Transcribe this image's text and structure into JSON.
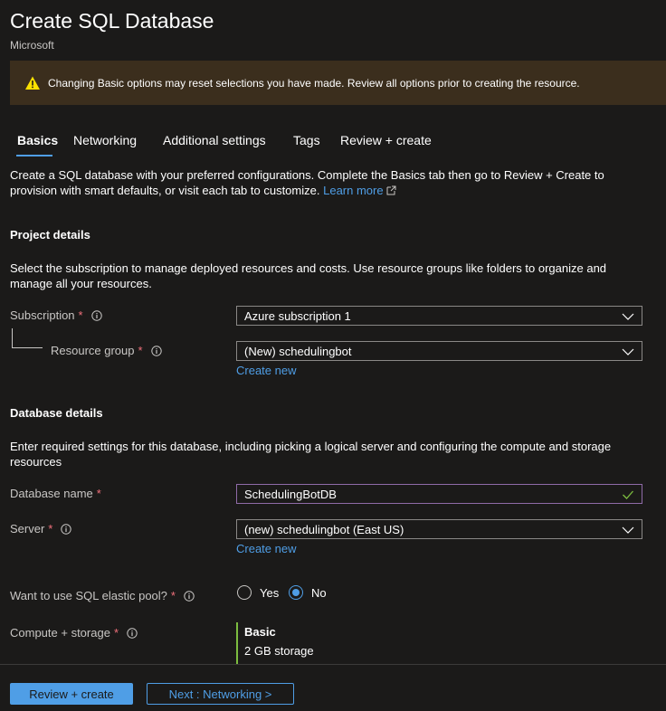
{
  "header": {
    "title": "Create SQL Database",
    "subtitle": "Microsoft"
  },
  "warning": {
    "text": "Changing Basic options may reset selections you have made. Review all options prior to creating the resource."
  },
  "tabs": [
    {
      "label": "Basics",
      "active": true
    },
    {
      "label": "Networking",
      "active": false
    },
    {
      "label": "Additional settings",
      "active": false
    },
    {
      "label": "Tags",
      "active": false
    },
    {
      "label": "Review + create",
      "active": false
    }
  ],
  "intro": {
    "text": "Create a SQL database with your preferred configurations. Complete the Basics tab then go to Review + Create to provision with smart defaults, or visit each tab to customize.",
    "link": "Learn more"
  },
  "project": {
    "title": "Project details",
    "description": "Select the subscription to manage deployed resources and costs. Use resource groups like folders to organize and manage all your resources.",
    "subscription_label": "Subscription",
    "subscription_value": "Azure subscription 1",
    "resource_group_label": "Resource group",
    "resource_group_value": "(New) schedulingbot",
    "create_new": "Create new"
  },
  "database": {
    "title": "Database details",
    "description": "Enter required settings for this database, including picking a logical server and configuring the compute and storage resources",
    "name_label": "Database name",
    "name_value": "SchedulingBotDB",
    "server_label": "Server",
    "server_value": "(new) schedulingbot (East US)",
    "create_new": "Create new",
    "elastic_label": "Want to use SQL elastic pool?",
    "elastic_yes": "Yes",
    "elastic_no": "No",
    "elastic_selected": "No",
    "compute_label": "Compute + storage",
    "compute_tier": "Basic",
    "compute_storage": "2 GB storage"
  },
  "footer": {
    "review_create": "Review + create",
    "next": "Next : Networking >"
  },
  "colors": {
    "accent": "#4f9ee6",
    "required": "#f1707b",
    "valid": "#7cbc3f",
    "warning_bg": "#3b2e1d"
  }
}
